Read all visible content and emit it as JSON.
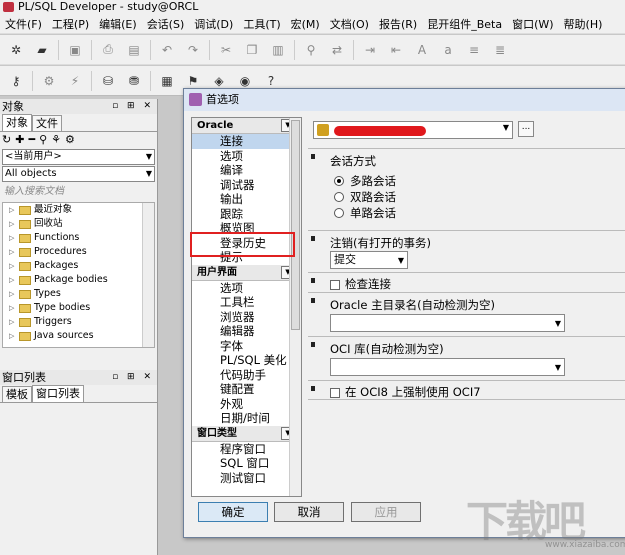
{
  "window": {
    "title": "PL/SQL Developer - study@ORCL"
  },
  "menu": [
    "文件(F)",
    "工程(P)",
    "编辑(E)",
    "会话(S)",
    "调试(D)",
    "工具(T)",
    "宏(M)",
    "文档(O)",
    "报告(R)",
    "昆开组件_Beta",
    "窗口(W)",
    "帮助(H)"
  ],
  "left_panel": {
    "header": "对象",
    "tabs": [
      "对象",
      "文件"
    ],
    "user_combo": "<当前用户>",
    "filter_combo": "All objects",
    "search_placeholder": "输入搜索文档",
    "tree_items": [
      "最近对象",
      "回收站",
      "Functions",
      "Procedures",
      "Packages",
      "Package bodies",
      "Types",
      "Type bodies",
      "Triggers",
      "Java sources"
    ],
    "window_list_header": "窗口列表",
    "window_list_tabs": [
      "模板",
      "窗口列表"
    ]
  },
  "dialog": {
    "title": "首选项",
    "nav": {
      "group_oracle": "Oracle",
      "oracle_items": [
        "连接",
        "选项",
        "编译",
        "调试器",
        "输出",
        "跟踪",
        "概览图",
        "登录历史",
        "提示"
      ],
      "group_ui": "用户界面",
      "ui_items": [
        "选项",
        "工具栏",
        "浏览器",
        "编辑器",
        "字体",
        "PL/SQL 美化",
        "代码助手",
        "键配置",
        "外观",
        "日期/时间"
      ],
      "group_window": "窗口类型",
      "window_items": [
        "程序窗口",
        "SQL 窗口",
        "测试窗口"
      ]
    },
    "dots_button": "...",
    "session_mode": {
      "label": "会话方式",
      "options": [
        "多路会话",
        "双路会话",
        "单路会话"
      ],
      "selected": "多路会话"
    },
    "logoff": {
      "label": "注销(有打开的事务)",
      "value": "提交"
    },
    "check_connection": "检查连接",
    "oracle_home": {
      "label": "Oracle 主目录名(自动检测为空)",
      "value": ""
    },
    "oci_library": {
      "label": "OCI 库(自动检测为空)",
      "value": ""
    },
    "force_oci7": "在 OCI8 上强制使用 OCI7",
    "buttons": {
      "ok": "确定",
      "cancel": "取消",
      "apply": "应用"
    }
  },
  "watermark": {
    "text": "下载吧",
    "sub": "www.xiazaiba.com"
  },
  "colors": {
    "highlight_box": "#e02020",
    "selected_nav": "#c0d6ee"
  }
}
